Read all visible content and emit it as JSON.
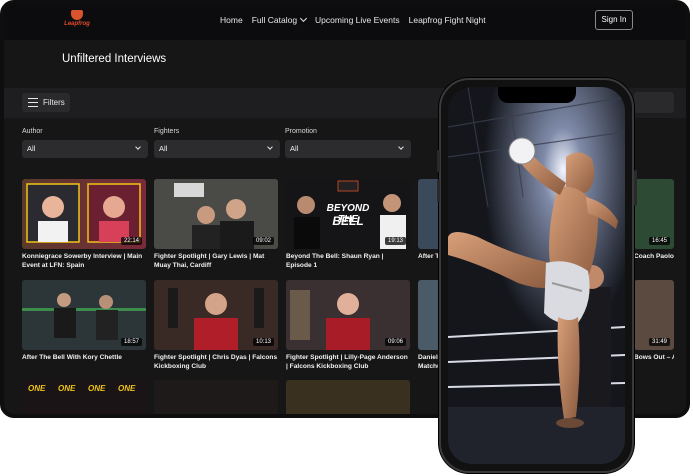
{
  "nav": {
    "logo_text": "Leapfrog",
    "links": [
      "Home",
      "Full Catalog",
      "Upcoming Live Events",
      "Leapfrog Fight Night"
    ],
    "signin": "Sign In"
  },
  "page": {
    "title": "Unfiltered Interviews"
  },
  "filters": {
    "button": "Filters",
    "groups": [
      {
        "label": "Author",
        "value": "All"
      },
      {
        "label": "Fighters",
        "value": "All"
      },
      {
        "label": "Promotion",
        "value": "All"
      }
    ]
  },
  "videos": [
    {
      "title": "Konniegrace Sowerby Interview | Main Event at LFN: Spain",
      "duration": "22:14"
    },
    {
      "title": "Fighter Spotlight | Gary Lewis | Mat Muay Thai, Cardiff",
      "duration": "09:02"
    },
    {
      "title": "Beyond The Bell: Shaun Ryan | Episode 1",
      "duration": "19:13",
      "thumb_text": [
        "BEYOND THE",
        "BELL"
      ]
    },
    {
      "title": "After Th",
      "duration": ""
    },
    {
      "title": "After The Bell With Kory Chettle",
      "duration": "18:57"
    },
    {
      "title": "Fighter Spotlight | Chris Dyas | Falcons Kickboxing Club",
      "duration": "10:13"
    },
    {
      "title": "Fighter Spotlight | Lilly-Page Anderson | Falcons Kickboxing Club",
      "duration": "09:06"
    },
    {
      "title": "Daniela Matchup",
      "duration": ""
    }
  ],
  "peek_right": [
    {
      "title": "Coach Paolo",
      "duration": "16:45"
    },
    {
      "title": "Bows Out – A",
      "duration": "31:49"
    }
  ],
  "third_row_label": "ONE",
  "colors": {
    "accent": "#d9532c",
    "nav_bg": "#0c0c0e",
    "page_bg": "#161616"
  }
}
